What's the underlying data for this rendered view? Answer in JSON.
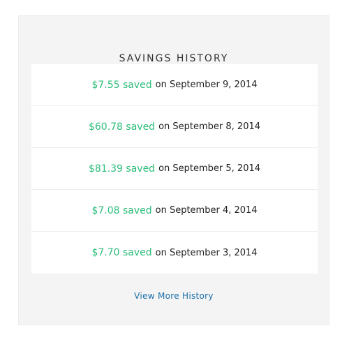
{
  "savings_history": {
    "title": "SAVINGS HISTORY",
    "entries": [
      {
        "amount": "$7.55 saved",
        "date_text": "on September 9, 2014"
      },
      {
        "amount": "$60.78 saved",
        "date_text": "on September 8, 2014"
      },
      {
        "amount": "$81.39 saved",
        "date_text": "on September 5, 2014"
      },
      {
        "amount": "$7.08 saved",
        "date_text": "on September 4, 2014"
      },
      {
        "amount": "$7.70 saved",
        "date_text": "on September 3, 2014"
      }
    ],
    "view_more_label": "View More History"
  },
  "colors": {
    "amount": "#2dbd7a",
    "link": "#1a6ea8",
    "card_background": "#f4f4f4"
  }
}
